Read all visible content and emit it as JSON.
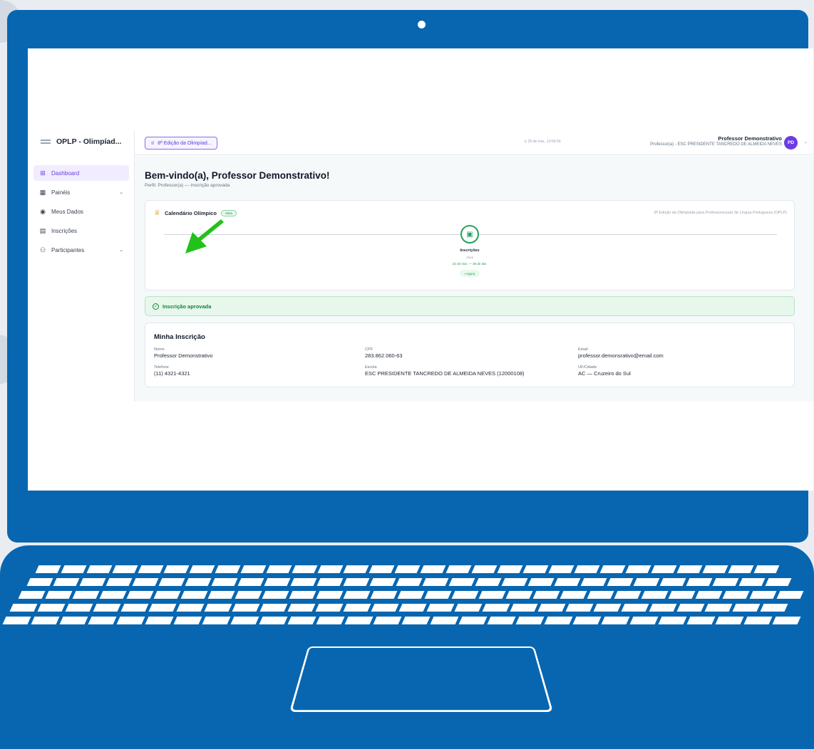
{
  "app": {
    "brand": "OPLP - Olimpíad...",
    "nav": [
      {
        "label": "Dashboard",
        "icon": "grid-icon",
        "active": true
      },
      {
        "label": "Painéis",
        "icon": "panels-icon",
        "expandable": true
      },
      {
        "label": "Meus Dados",
        "icon": "user-circle-icon"
      },
      {
        "label": "Inscrições",
        "icon": "document-icon"
      },
      {
        "label": "Participantes",
        "icon": "users-icon",
        "expandable": true
      }
    ],
    "topbar": {
      "edition": "8ª Edição da Olimpíad...",
      "clock": "25 de mar., 10:56:56",
      "user_name": "Professor Demonstrativo",
      "user_role": "Professor(a) - ESC PRESIDENTE TANCREDO DE ALMEIDA NEVES",
      "avatar_initials": "PD"
    },
    "page": {
      "title": "Bem-vindo(a), Professor Demonstrativo!",
      "subtitle": "Perfil: Professor(a) — Inscrição aprovada"
    },
    "calendar": {
      "title": "Calendário Olímpico",
      "badge": "Ativa",
      "edition_full": "8ª Edição da Olimpíada para Professores(as) de Língua Portuguesa (OPLP)",
      "step": {
        "name": "Inscrições",
        "status": "Ativa",
        "dates": "22 de mar. — 30 de abr.",
        "now_label": "• Agora"
      }
    },
    "approval_banner": "Inscrição aprovada",
    "registration": {
      "title": "Minha Inscrição",
      "fields": {
        "nome": {
          "label": "Nome",
          "value": "Professor Demonstrativo"
        },
        "cpf": {
          "label": "CPF",
          "value": "283.862.060-63"
        },
        "email": {
          "label": "Email",
          "value": "professor.demonsrativo@email.com"
        },
        "telefone": {
          "label": "Telefone",
          "value": "(11) 4321-4321"
        },
        "escola": {
          "label": "Escola",
          "value": "ESC PRESIDENTE TANCREDO DE ALMEIDA NEVES (12000108)"
        },
        "uf_cidade": {
          "label": "UF/Cidade",
          "value": "AC — Cruzeiro do Sul"
        }
      }
    }
  },
  "colors": {
    "laptop": "#0866b0",
    "accent": "#6b3de0",
    "success": "#15803d",
    "arrow": "#21c21a"
  }
}
